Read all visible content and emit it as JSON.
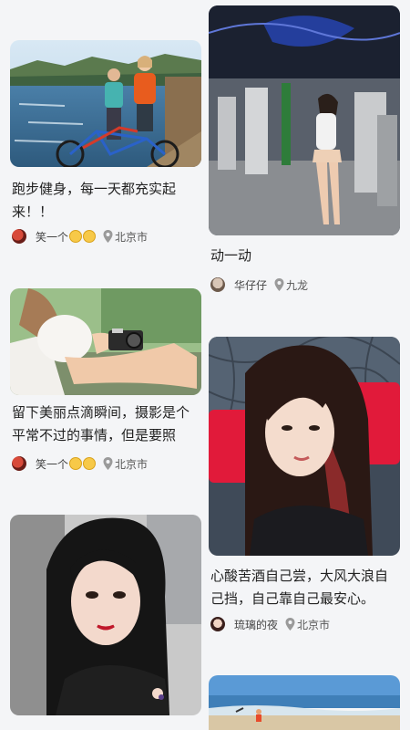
{
  "feed": {
    "left": [
      {
        "caption": "跑步健身，每一天都充实起来！！",
        "user": "笑一个",
        "location": "北京市",
        "image_alt": "couple-with-bicycle-by-lake"
      },
      {
        "caption": "留下美丽点滴瞬间，摄影是个平常不过的事情，但是要照片…",
        "user": "笑一个",
        "location": "北京市",
        "image_alt": "woman-holding-camera"
      },
      {
        "image_alt": "woman-in-car-selfie"
      }
    ],
    "right": [
      {
        "caption": "动一动",
        "user": "华仔仔",
        "location": "九龙",
        "image_alt": "woman-in-gym"
      },
      {
        "caption": "心酸苦酒自己尝，大风大浪自己挡，自己靠自己最安心。",
        "user": "琉璃的夜",
        "location": "北京市",
        "image_alt": "woman-selfie-red-chair"
      },
      {
        "image_alt": "seaside-beach"
      }
    ]
  },
  "colors": {
    "background": "#f4f5f7",
    "text": "#222222",
    "meta_text": "#444444",
    "pin": "#9a9a9a"
  }
}
